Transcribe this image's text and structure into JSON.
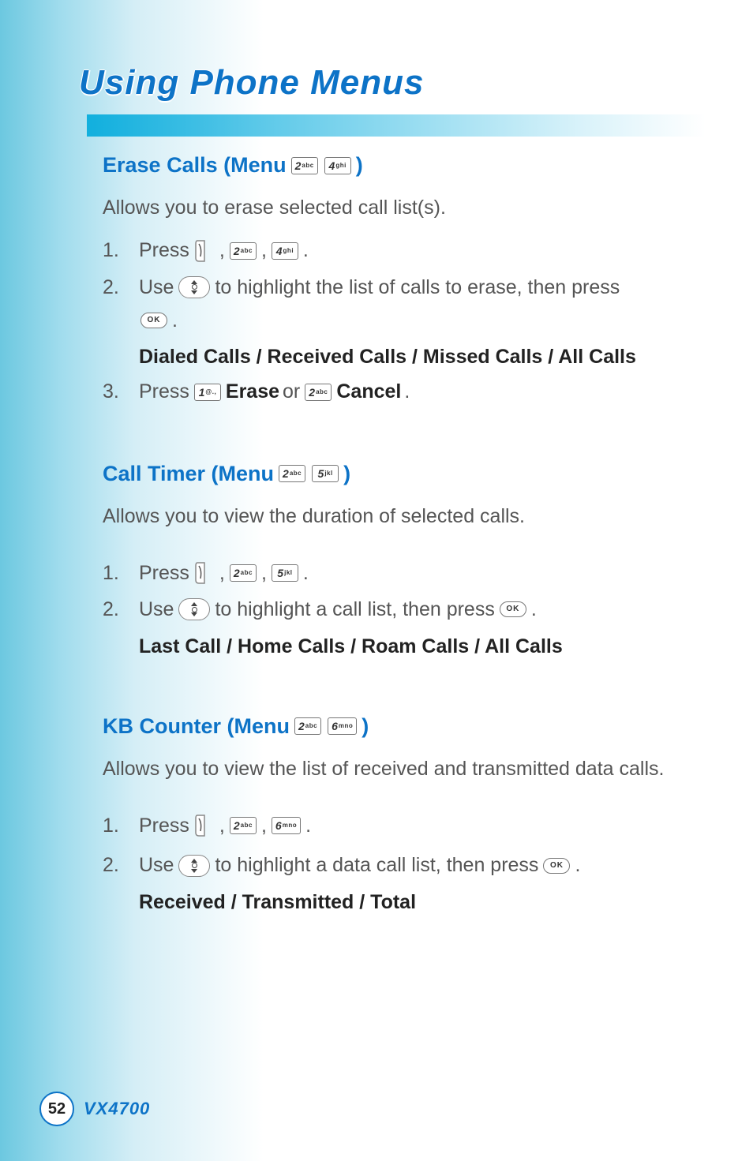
{
  "page_title": "Using Phone Menus",
  "footer": {
    "page_number": "52",
    "model": "VX4700"
  },
  "keys": {
    "k1": {
      "big": "1",
      "small": "@.,"
    },
    "k2": {
      "big": "2",
      "small": "abc"
    },
    "k4": {
      "big": "4",
      "small": "ghi"
    },
    "k5": {
      "big": "5",
      "small": "jkl"
    },
    "k6": {
      "big": "6",
      "small": "mno"
    },
    "ok": "OK"
  },
  "sections": [
    {
      "id": "erase",
      "heading_prefix": "Erase Calls (Menu ",
      "heading_keys": [
        "k2",
        "k4"
      ],
      "heading_suffix": ")",
      "desc": "Allows you to erase selected call list(s).",
      "steps": [
        {
          "n": "1.",
          "type": "press",
          "prefix": "Press ",
          "press_keys": [
            "soft",
            "k2",
            "k4"
          ],
          "suffix": "."
        },
        {
          "n": "2.",
          "type": "nav",
          "line1_a": "Use ",
          "line1_b": " to highlight the list of calls to erase, then press",
          "line2_suffix": " ."
        },
        {
          "options": "Dialed Calls / Received Calls / Missed Calls / All Calls"
        },
        {
          "n": "3.",
          "type": "erase",
          "a": "Press ",
          "b": " Erase",
          "c": " or ",
          "d": " Cancel",
          "e": "."
        }
      ]
    },
    {
      "id": "timer",
      "heading_prefix": "Call Timer (Menu ",
      "heading_keys": [
        "k2",
        "k5"
      ],
      "heading_suffix": ")",
      "desc": "Allows you to view the duration of selected calls.",
      "steps": [
        {
          "n": "1.",
          "type": "press",
          "prefix": "Press ",
          "press_keys": [
            "soft",
            "k2",
            "k5"
          ],
          "suffix": "."
        },
        {
          "n": "2.",
          "type": "nav-inline",
          "a": "Use ",
          "b": " to highlight a call list, then press ",
          "c": " ."
        },
        {
          "options": "Last Call / Home Calls / Roam Calls / All Calls"
        }
      ]
    },
    {
      "id": "kb",
      "heading_prefix": "KB Counter (Menu ",
      "heading_keys": [
        "k2",
        "k6"
      ],
      "heading_suffix": ")",
      "desc": "Allows you to view the list of received and transmitted data calls.",
      "steps": [
        {
          "n": "1.",
          "type": "press",
          "prefix": "Press ",
          "press_keys": [
            "soft",
            "k2",
            "k6"
          ],
          "suffix": "."
        },
        {
          "n": "2.",
          "type": "nav-inline",
          "a": "Use ",
          "b": " to highlight a data call list, then press ",
          "c": " ."
        },
        {
          "options": "Received / Transmitted / Total"
        }
      ]
    }
  ]
}
